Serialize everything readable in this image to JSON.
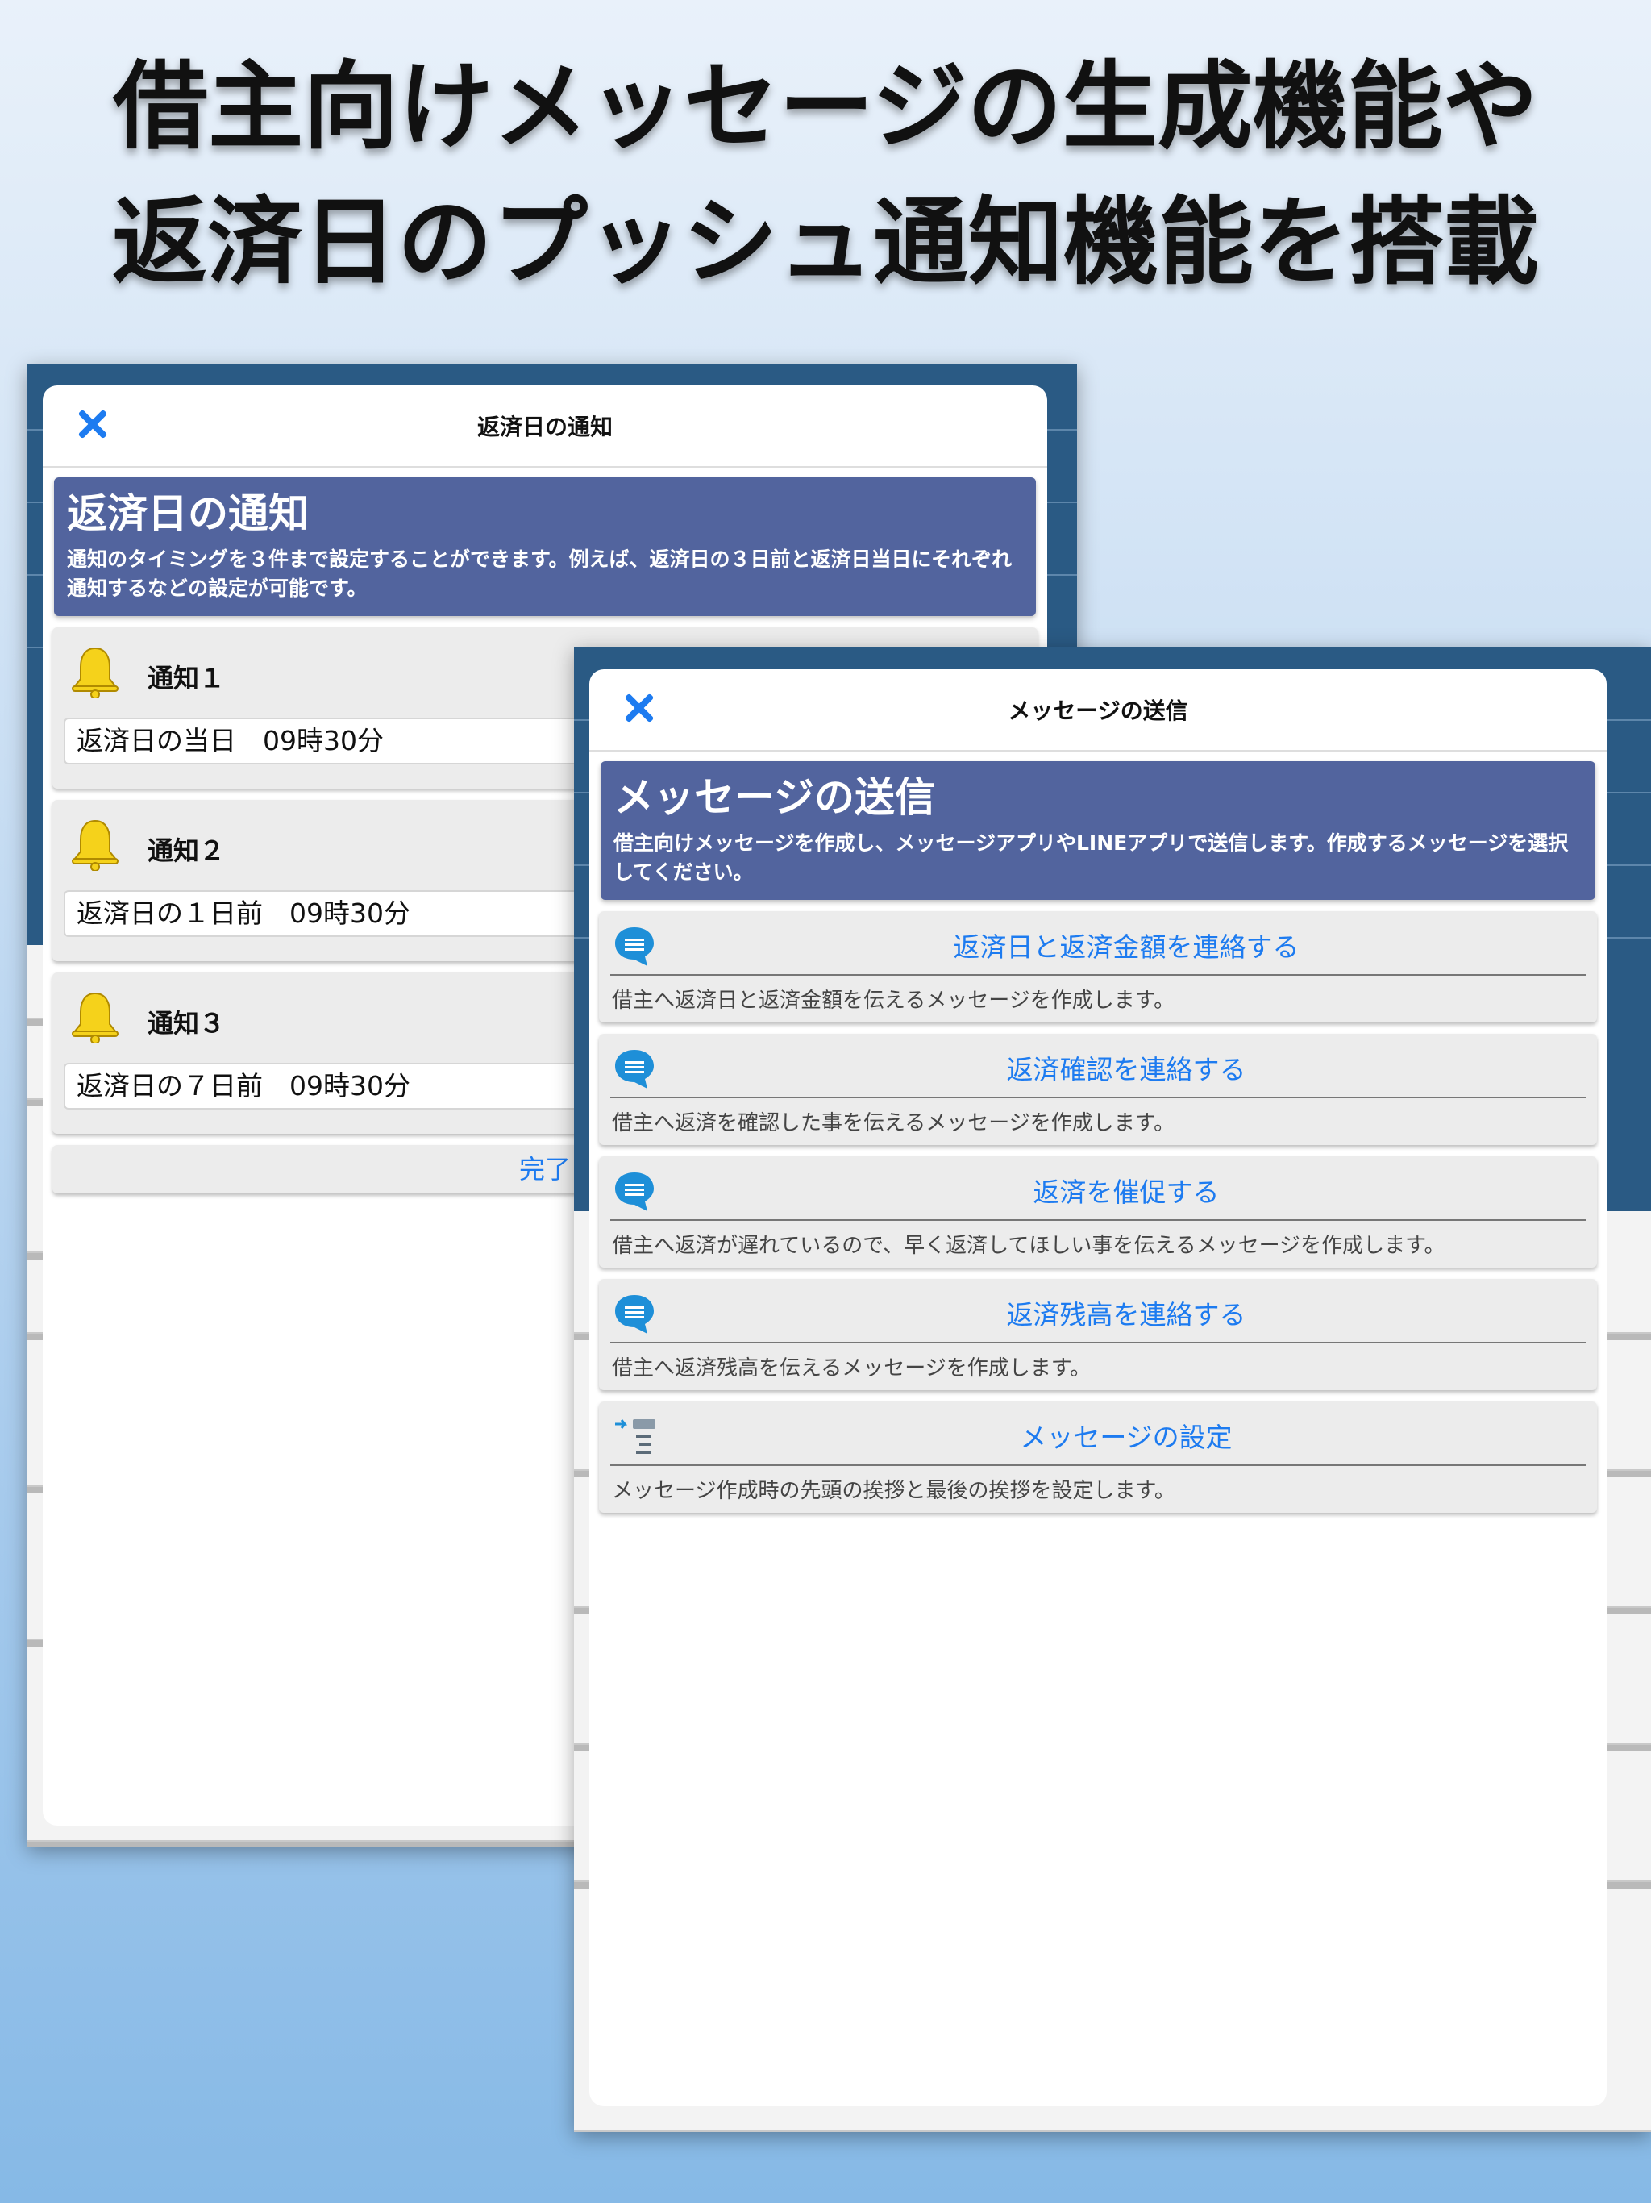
{
  "headline": {
    "line1": "借主向けメッセージの生成機能や",
    "line2": "返済日のプッシュ通知機能を搭載"
  },
  "notification_sheet": {
    "nav_title": "返済日の通知",
    "close_icon": "close-icon",
    "banner_title": "返済日の通知",
    "banner_desc": "通知のタイミングを３件まで設定することができます。例えば、返済日の３日前と返済日当日にそれぞれ通知するなどの設定が可能です。",
    "items": [
      {
        "label": "通知１",
        "value": "返済日の当日　09時30分",
        "icon": "bell-icon"
      },
      {
        "label": "通知２",
        "value": "返済日の１日前　09時30分",
        "icon": "bell-icon"
      },
      {
        "label": "通知３",
        "value": "返済日の７日前　09時30分",
        "icon": "bell-icon"
      }
    ],
    "done_label": "完了"
  },
  "message_sheet": {
    "nav_title": "メッセージの送信",
    "close_icon": "close-icon",
    "banner_title": "メッセージの送信",
    "banner_desc": "借主向けメッセージを作成し、メッセージアプリやLINEアプリで送信します。作成するメッセージを選択してください。",
    "items": [
      {
        "title": "返済日と返済金額を連絡する",
        "desc": "借主へ返済日と返済金額を伝えるメッセージを作成します。",
        "icon": "chat-bubble-icon"
      },
      {
        "title": "返済確認を連絡する",
        "desc": "借主へ返済を確認した事を伝えるメッセージを作成します。",
        "icon": "chat-bubble-icon"
      },
      {
        "title": "返済を催促する",
        "desc": "借主へ返済が遅れているので、早く返済してほしい事を伝えるメッセージを作成します。",
        "icon": "chat-bubble-icon"
      },
      {
        "title": "返済残高を連絡する",
        "desc": "借主へ返済残高を伝えるメッセージを作成します。",
        "icon": "chat-bubble-icon"
      },
      {
        "title": "メッセージの設定",
        "desc": "メッセージ作成時の先頭の挨拶と最後の挨拶を設定します。",
        "icon": "settings-list-icon"
      }
    ]
  },
  "colors": {
    "accent": "#1d7bf0",
    "banner": "#52649e",
    "frame": "#2a5a84",
    "bell": "#f5d21b"
  }
}
